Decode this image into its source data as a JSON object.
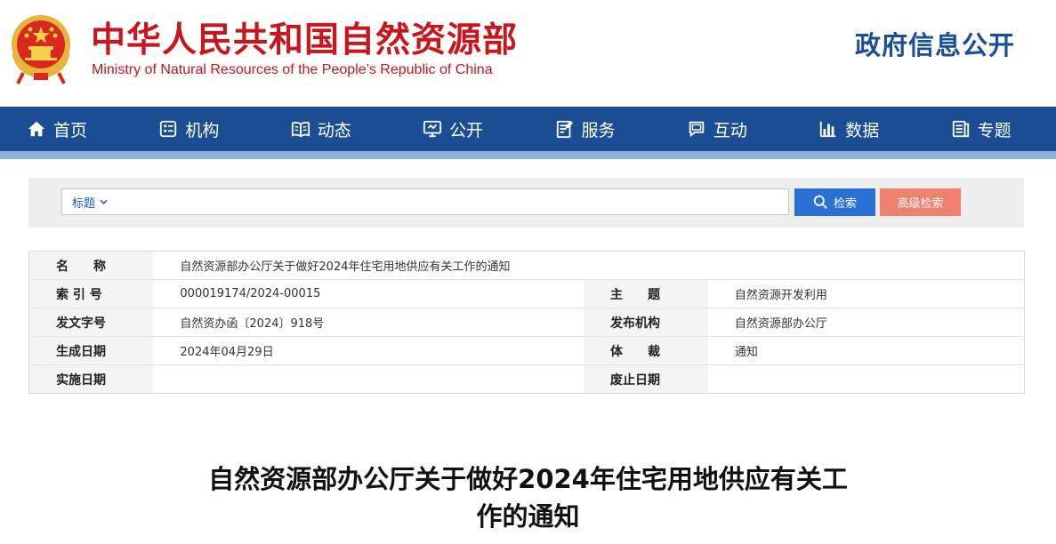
{
  "header": {
    "title_cn": "中华人民共和国自然资源部",
    "title_en": "Ministry of Natural Resources of the People’s Republic of China",
    "gov_info": "政府信息公开",
    "brand_red": "#c8161d",
    "brand_blue": "#1a4f96"
  },
  "nav": {
    "items": [
      {
        "label": "首页",
        "icon": "home-icon"
      },
      {
        "label": "机构",
        "icon": "org-icon"
      },
      {
        "label": "动态",
        "icon": "book-icon"
      },
      {
        "label": "公开",
        "icon": "monitor-icon"
      },
      {
        "label": "服务",
        "icon": "document-edit-icon"
      },
      {
        "label": "互动",
        "icon": "chat-icon"
      },
      {
        "label": "数据",
        "icon": "bar-chart-icon"
      },
      {
        "label": "专题",
        "icon": "topic-icon"
      }
    ],
    "bg": "#1a4d93"
  },
  "search": {
    "scope_selected": "标题",
    "query": "",
    "search_label": "检索",
    "advanced_label": "高级检索"
  },
  "info": {
    "name_label": "名　　称",
    "name_value": "自然资源部办公厅关于做好2024年住宅用地供应有关工作的通知",
    "index_label": "索 引 号",
    "index_value": "000019174/2024-00015",
    "subject_label": "主　　题",
    "subject_value": "自然资源开发利用",
    "docno_label": "发文字号",
    "docno_value": "自然资办函〔2024〕918号",
    "publisher_label": "发布机构",
    "publisher_value": "自然资源部办公厅",
    "date_label": "生成日期",
    "date_value": "2024年04月29日",
    "genre_label": "体　　裁",
    "genre_value": "通知",
    "effective_label": "实施日期",
    "effective_value": "",
    "expiry_label": "废止日期",
    "expiry_value": ""
  },
  "article": {
    "title_line1": "自然资源部办公厅关于做好2024年住宅用地供应有关工",
    "title_line2": "作的通知"
  }
}
